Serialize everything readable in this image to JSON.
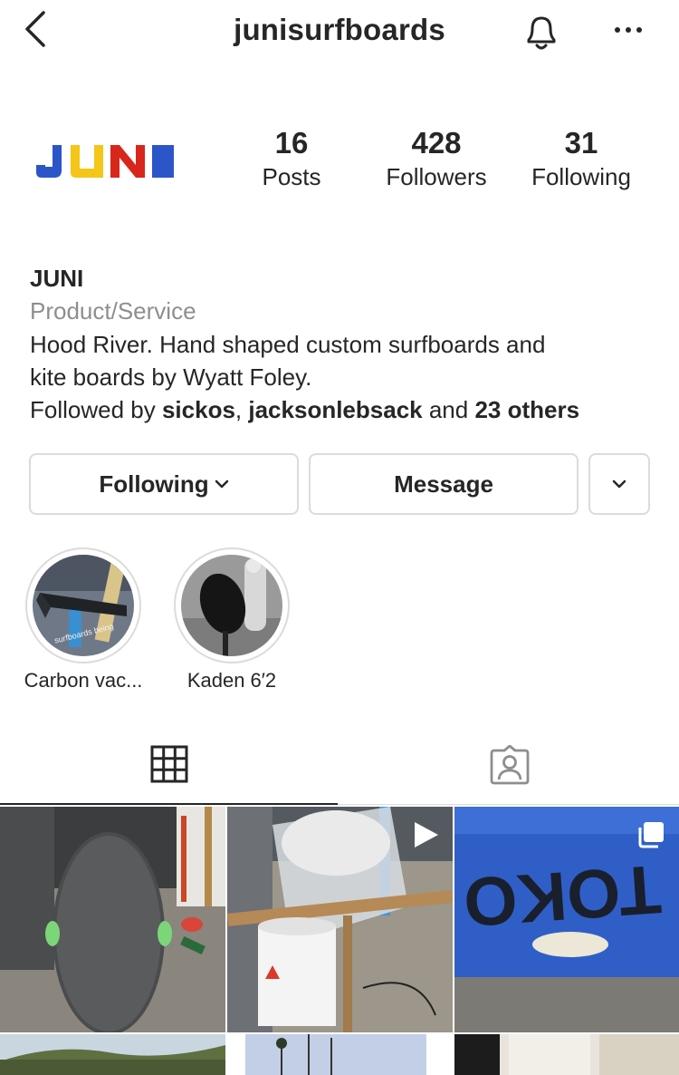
{
  "header": {
    "username": "junisurfboards"
  },
  "profile": {
    "logo_text": "JUNI",
    "stats": {
      "posts": {
        "count": "16",
        "label": "Posts"
      },
      "followers": {
        "count": "428",
        "label": "Followers"
      },
      "following": {
        "count": "31",
        "label": "Following"
      }
    }
  },
  "bio": {
    "name": "JUNI",
    "category": "Product/Service",
    "desc_line1": "Hood River. Hand shaped custom surfboards and",
    "desc_line2": "kite boards by Wyatt Foley.",
    "followed_prefix": "Followed by ",
    "followed_user1": "sickos",
    "followed_sep": ", ",
    "followed_user2": "jacksonlebsack",
    "followed_and": " and ",
    "followed_others": "23 others"
  },
  "actions": {
    "following_label": "Following",
    "message_label": "Message"
  },
  "highlights": [
    {
      "label": "Carbon vac...",
      "overlay_text": "surfboards being"
    },
    {
      "label": "Kaden 6′2"
    }
  ],
  "posts": [
    {
      "type": "image"
    },
    {
      "type": "video"
    },
    {
      "type": "carousel",
      "text_in_image": "TOKO"
    },
    {
      "type": "image"
    },
    {
      "type": "image"
    },
    {
      "type": "image"
    }
  ],
  "colors": {
    "text": "#262626",
    "secondary": "#8e8e8e",
    "border": "#dbdbdb",
    "logo_blue": "#2b55c9",
    "logo_yellow": "#f5c518",
    "logo_red": "#d9261c"
  }
}
